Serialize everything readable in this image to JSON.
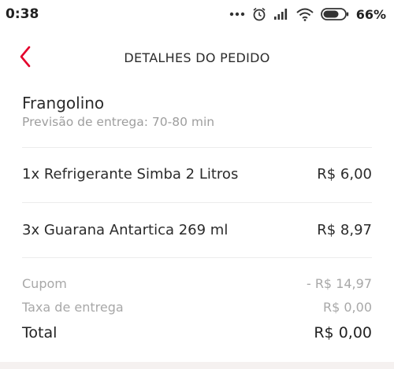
{
  "status_bar": {
    "time": "0:38",
    "battery": "66%",
    "icons": [
      "more-dots-icon",
      "alarm-icon",
      "signal-icon",
      "wifi-icon",
      "battery-icon"
    ]
  },
  "header": {
    "title": "DETALHES DO PEDIDO",
    "back_icon": "chevron-left-icon",
    "accent_color": "#e4002b"
  },
  "restaurant": {
    "name": "Frangolino",
    "estimate": "Previsão de entrega: 70-80 min"
  },
  "items": [
    {
      "label": "1x Refrigerante Simba 2 Litros",
      "price": "R$ 6,00"
    },
    {
      "label": "3x Guarana Antartica 269 ml",
      "price": "R$ 8,97"
    }
  ],
  "summary": {
    "coupon_label": "Cupom",
    "coupon_value": "- R$ 14,97",
    "delivery_fee_label": "Taxa de entrega",
    "delivery_fee_value": "R$ 0,00",
    "total_label": "Total",
    "total_value": "R$ 0,00"
  }
}
